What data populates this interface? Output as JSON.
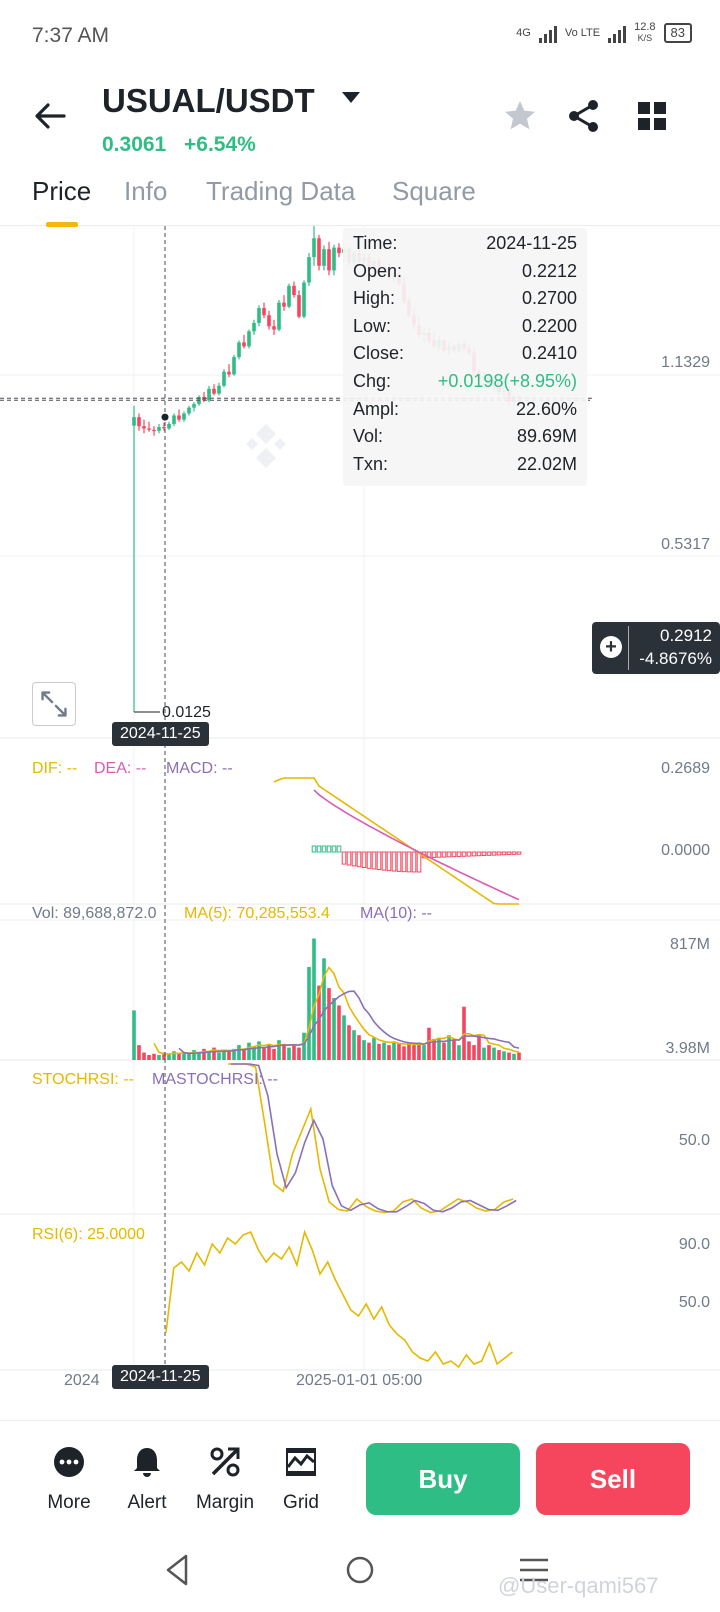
{
  "status": {
    "time": "7:37 AM",
    "net1": "4G",
    "net2": "Vo LTE",
    "speed_value": "12.8",
    "speed_unit": "K/S",
    "battery": "83"
  },
  "header": {
    "pair": "USUAL/USDT",
    "price": "0.3061",
    "change": "+6.54%",
    "icons": [
      "back-arrow-icon",
      "star-icon",
      "share-icon",
      "grid-icon"
    ]
  },
  "tabs": [
    {
      "label": "Price",
      "active": true
    },
    {
      "label": "Info",
      "active": false
    },
    {
      "label": "Trading Data",
      "active": false
    },
    {
      "label": "Square",
      "active": false
    }
  ],
  "tooltip": {
    "rows": [
      {
        "k": "Time:",
        "v": "2024-11-25"
      },
      {
        "k": "Open:",
        "v": "0.2212"
      },
      {
        "k": "High:",
        "v": "0.2700"
      },
      {
        "k": "Low:",
        "v": "0.2200"
      },
      {
        "k": "Close:",
        "v": "0.2410"
      },
      {
        "k": "Chg:",
        "v": "+0.0198(+8.95%)"
      },
      {
        "k": "Ampl:",
        "v": "22.60%"
      },
      {
        "k": "Vol:",
        "v": "89.69M"
      },
      {
        "k": "Txn:",
        "v": "22.02M"
      }
    ]
  },
  "price_axis": {
    "top": "1.1329",
    "mid": "0.5317"
  },
  "current_price": {
    "price": "0.2912",
    "pct": "-4.8676%"
  },
  "low_label": "0.0125",
  "crosshair_date": "2024-11-25",
  "macd": {
    "dif": "DIF: --",
    "dea": "DEA: --",
    "macd": "MACD: --",
    "axis_top": "0.2689",
    "axis_zero": "0.0000"
  },
  "volume": {
    "vol": "Vol: 89,688,872.0",
    "ma5": "MA(5): 70,285,553.4",
    "ma10": "MA(10): --",
    "axis_top": "817M",
    "axis_bottom": "3.98M"
  },
  "stochrsi": {
    "label": "STOCHRSI: --",
    "ma": "MASTOCHRSI: --",
    "axis_mid": "50.0"
  },
  "rsi": {
    "label": "RSI(6): 25.0000",
    "axis_top": "90.0",
    "axis_mid": "50.0"
  },
  "time_axis": {
    "left": "2024",
    "mid": "2025-01-01 05:00"
  },
  "bottom_bar": {
    "more": "More",
    "alert": "Alert",
    "margin": "Margin",
    "grid": "Grid",
    "buy": "Buy",
    "sell": "Sell"
  },
  "watermark": "@User-qami567",
  "colors": {
    "up": "#2ebd85",
    "down": "#f6465d",
    "accent": "#f0b90b",
    "dif": "#e6b800",
    "dea": "#d85cb5",
    "macd": "#8a6fb8"
  },
  "chart_data": {
    "type": "candlestick",
    "candles": [
      [
        0.2212,
        0.27,
        0.0125,
        0.241
      ],
      [
        0.241,
        0.25,
        0.21,
        0.22
      ],
      [
        0.22,
        0.235,
        0.205,
        0.215
      ],
      [
        0.215,
        0.23,
        0.208,
        0.212
      ],
      [
        0.212,
        0.22,
        0.2,
        0.21
      ],
      [
        0.21,
        0.225,
        0.205,
        0.218
      ],
      [
        0.218,
        0.228,
        0.21,
        0.215
      ],
      [
        0.215,
        0.23,
        0.212,
        0.225
      ],
      [
        0.225,
        0.25,
        0.22,
        0.245
      ],
      [
        0.245,
        0.26,
        0.23,
        0.235
      ],
      [
        0.235,
        0.255,
        0.23,
        0.25
      ],
      [
        0.25,
        0.27,
        0.245,
        0.265
      ],
      [
        0.265,
        0.28,
        0.255,
        0.275
      ],
      [
        0.275,
        0.3,
        0.27,
        0.295
      ],
      [
        0.295,
        0.31,
        0.28,
        0.285
      ],
      [
        0.285,
        0.33,
        0.28,
        0.32
      ],
      [
        0.32,
        0.335,
        0.3,
        0.305
      ],
      [
        0.305,
        0.34,
        0.3,
        0.33
      ],
      [
        0.33,
        0.39,
        0.325,
        0.38
      ],
      [
        0.38,
        0.41,
        0.36,
        0.37
      ],
      [
        0.37,
        0.45,
        0.365,
        0.44
      ],
      [
        0.44,
        0.52,
        0.43,
        0.51
      ],
      [
        0.51,
        0.55,
        0.48,
        0.49
      ],
      [
        0.49,
        0.58,
        0.48,
        0.57
      ],
      [
        0.57,
        0.64,
        0.55,
        0.62
      ],
      [
        0.62,
        0.74,
        0.6,
        0.72
      ],
      [
        0.72,
        0.76,
        0.65,
        0.67
      ],
      [
        0.67,
        0.7,
        0.58,
        0.6
      ],
      [
        0.6,
        0.64,
        0.55,
        0.58
      ],
      [
        0.58,
        0.78,
        0.57,
        0.76
      ],
      [
        0.76,
        0.82,
        0.7,
        0.73
      ],
      [
        0.73,
        0.92,
        0.72,
        0.9
      ],
      [
        0.9,
        0.94,
        0.8,
        0.82
      ],
      [
        0.82,
        0.86,
        0.65,
        0.66
      ],
      [
        0.66,
        0.95,
        0.65,
        0.93
      ],
      [
        0.93,
        1.25,
        0.9,
        1.2
      ],
      [
        1.2,
        1.64,
        1.1,
        1.45
      ],
      [
        1.45,
        1.5,
        1.05,
        1.1
      ],
      [
        1.1,
        1.35,
        1.05,
        1.3
      ],
      [
        1.3,
        1.4,
        1.0,
        1.05
      ],
      [
        1.05,
        1.36,
        1.0,
        1.32
      ],
      [
        1.32,
        1.38,
        1.2,
        1.25
      ],
      [
        1.25,
        1.35,
        1.15,
        1.3
      ],
      [
        1.3,
        1.32,
        1.1,
        1.14
      ],
      [
        1.14,
        1.28,
        1.1,
        1.25
      ],
      [
        1.25,
        1.3,
        1.1,
        1.15
      ],
      [
        1.15,
        1.25,
        1.05,
        1.2
      ],
      [
        1.2,
        1.25,
        1.05,
        1.08
      ],
      [
        1.08,
        1.2,
        1.03,
        1.16
      ],
      [
        1.16,
        1.2,
        1.0,
        1.02
      ],
      [
        1.02,
        1.1,
        0.98,
        1.08
      ],
      [
        1.08,
        1.12,
        0.95,
        0.97
      ],
      [
        0.97,
        1.05,
        0.92,
        1.01
      ],
      [
        1.01,
        1.04,
        0.9,
        0.92
      ],
      [
        0.92,
        0.98,
        0.75,
        0.77
      ],
      [
        0.77,
        0.8,
        0.65,
        0.67
      ],
      [
        0.67,
        0.72,
        0.58,
        0.61
      ],
      [
        0.61,
        0.66,
        0.53,
        0.55
      ],
      [
        0.55,
        0.6,
        0.51,
        0.56
      ],
      [
        0.56,
        0.59,
        0.5,
        0.52
      ],
      [
        0.52,
        0.56,
        0.48,
        0.49
      ],
      [
        0.49,
        0.54,
        0.47,
        0.52
      ],
      [
        0.52,
        0.53,
        0.46,
        0.47
      ],
      [
        0.47,
        0.51,
        0.45,
        0.49
      ],
      [
        0.49,
        0.5,
        0.46,
        0.47
      ],
      [
        0.47,
        0.52,
        0.46,
        0.5
      ],
      [
        0.5,
        0.52,
        0.47,
        0.48
      ],
      [
        0.48,
        0.5,
        0.45,
        0.46
      ],
      [
        0.46,
        0.48,
        0.36,
        0.38
      ],
      [
        0.38,
        0.39,
        0.33,
        0.35
      ],
      [
        0.35,
        0.38,
        0.33,
        0.36
      ],
      [
        0.36,
        0.37,
        0.32,
        0.33
      ],
      [
        0.33,
        0.35,
        0.31,
        0.34
      ],
      [
        0.34,
        0.35,
        0.3,
        0.31
      ],
      [
        0.31,
        0.33,
        0.29,
        0.315
      ],
      [
        0.315,
        0.32,
        0.27,
        0.28
      ],
      [
        0.28,
        0.3,
        0.27,
        0.295
      ],
      [
        0.295,
        0.3,
        0.275,
        0.2912
      ]
    ],
    "volumes": [
      0.4,
      0.12,
      0.06,
      0.04,
      0.05,
      0.04,
      0.06,
      0.05,
      0.07,
      0.05,
      0.06,
      0.05,
      0.08,
      0.06,
      0.09,
      0.07,
      0.1,
      0.06,
      0.08,
      0.07,
      0.09,
      0.12,
      0.08,
      0.14,
      0.11,
      0.15,
      0.1,
      0.13,
      0.09,
      0.16,
      0.13,
      0.1,
      0.12,
      0.1,
      0.22,
      0.75,
      0.98,
      0.6,
      0.82,
      0.58,
      0.5,
      0.44,
      0.36,
      0.28,
      0.24,
      0.2,
      0.16,
      0.14,
      0.18,
      0.13,
      0.14,
      0.12,
      0.15,
      0.13,
      0.11,
      0.13,
      0.12,
      0.14,
      0.12,
      0.26,
      0.17,
      0.18,
      0.14,
      0.2,
      0.16,
      0.12,
      0.43,
      0.15,
      0.12,
      0.2,
      0.1,
      0.12,
      0.1,
      0.08,
      0.07,
      0.06,
      0.05,
      0.06
    ],
    "price_axis_ticks": [
      "1.1329",
      "0.5317"
    ],
    "volume_axis_ticks": [
      "817M",
      "3.98M"
    ]
  }
}
